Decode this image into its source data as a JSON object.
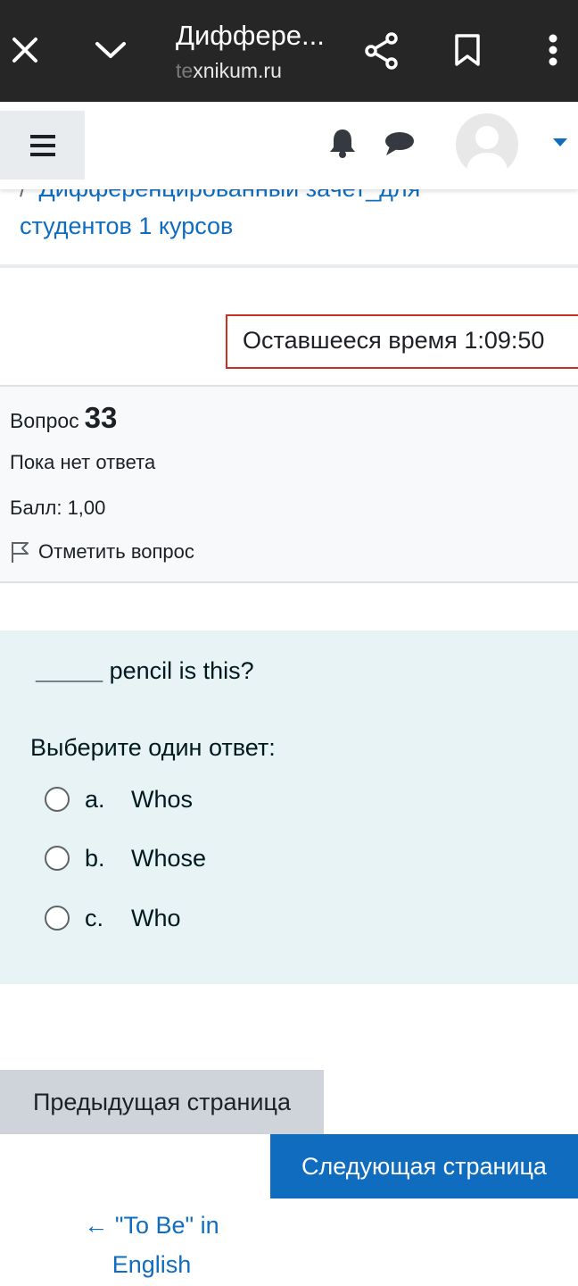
{
  "browser": {
    "title": "Диффере...",
    "host_faded": "te",
    "host": "xnikum.ru",
    "icons": [
      "close-icon",
      "chevron-down-icon",
      "share-icon",
      "bookmark-icon",
      "more-vert-icon"
    ]
  },
  "navbar": {
    "icons": [
      "menu-icon",
      "bell-icon",
      "chat-icon",
      "avatar",
      "caret-down-icon"
    ]
  },
  "breadcrumb": {
    "separator": "/",
    "line1": "Дифференцированный зачет_для",
    "line2": "студентов 1 курсов"
  },
  "timer": {
    "label": "Оставшееся время",
    "value": "1:09:50"
  },
  "question_info": {
    "label": "Вопрос",
    "number": "33",
    "state": "Пока нет ответа",
    "grade": "Балл: 1,00",
    "flag_label": "Отметить вопрос"
  },
  "question": {
    "blank": "_____",
    "text": " pencil is this?",
    "prompt": "Выберите один ответ:",
    "answers": [
      {
        "letter": "a.",
        "text": "Whos"
      },
      {
        "letter": "b.",
        "text": "Whose"
      },
      {
        "letter": "c.",
        "text": "Who"
      }
    ]
  },
  "navigation": {
    "prev_label": "Предыдущая страница",
    "next_label": "Следующая страница",
    "back_link": "← \"To Be\" in English"
  },
  "colors": {
    "chrome_bg": "#262626",
    "link": "#0f6cbf",
    "primary_button": "#0f6cbf",
    "timer_border": "#ca3120",
    "question_bg": "#e7f3f5"
  }
}
